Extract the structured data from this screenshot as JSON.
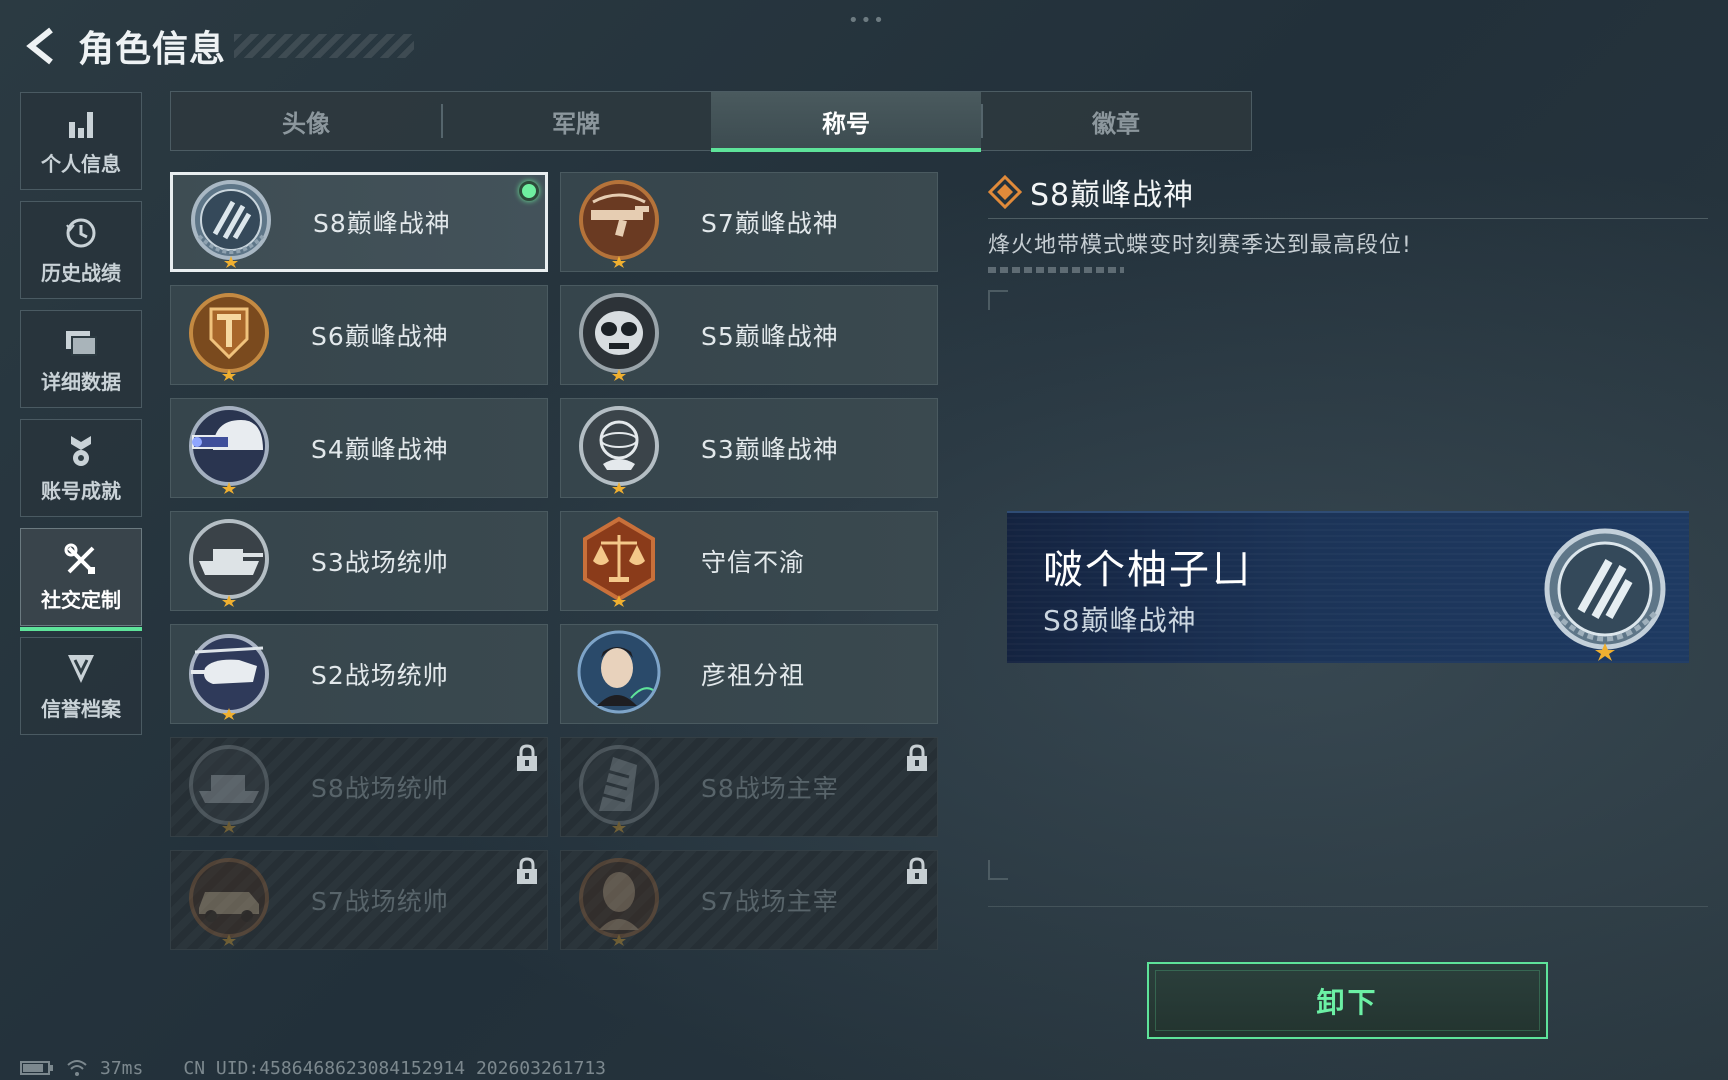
{
  "header": {
    "title": "角色信息",
    "top_dots": "•••"
  },
  "sidebar": {
    "items": [
      {
        "label": "个人信息",
        "icon": "bar-chart-icon"
      },
      {
        "label": "历史战绩",
        "icon": "history-clock-icon"
      },
      {
        "label": "详细数据",
        "icon": "folder-icon"
      },
      {
        "label": "账号成就",
        "icon": "medal-icon"
      },
      {
        "label": "社交定制",
        "icon": "tools-icon",
        "active": true
      },
      {
        "label": "信誉档案",
        "icon": "shield-badge-icon"
      }
    ]
  },
  "tabs": [
    {
      "label": "头像"
    },
    {
      "label": "军牌"
    },
    {
      "label": "称号",
      "active": true
    },
    {
      "label": "徽章"
    }
  ],
  "titles": [
    {
      "label": "S8巅峰战神",
      "badge": "s8-peak-emblem-icon",
      "state": "selected-equipped"
    },
    {
      "label": "S7巅峰战神",
      "badge": "s7-rifle-emblem-icon",
      "state": "owned"
    },
    {
      "label": "S6巅峰战神",
      "badge": "s6-t-shield-emblem-icon",
      "state": "owned"
    },
    {
      "label": "S5巅峰战神",
      "badge": "s5-skull-mask-emblem-icon",
      "state": "owned"
    },
    {
      "label": "S4巅峰战神",
      "badge": "s4-helmet-nvg-emblem-icon",
      "state": "owned"
    },
    {
      "label": "S3巅峰战神",
      "badge": "s3-armillary-emblem-icon",
      "state": "owned"
    },
    {
      "label": "S3战场统帅",
      "badge": "s3-tank-emblem-icon",
      "state": "owned"
    },
    {
      "label": "守信不渝",
      "badge": "scales-of-justice-emblem-icon",
      "state": "owned"
    },
    {
      "label": "S2战场统帅",
      "badge": "s2-helicopter-emblem-icon",
      "state": "owned"
    },
    {
      "label": "彦祖分祖",
      "badge": "portrait-emblem-icon",
      "state": "owned"
    },
    {
      "label": "S8战场统帅",
      "badge": "s8-tank-emblem-icon",
      "state": "locked"
    },
    {
      "label": "S8战场主宰",
      "badge": "s8-building-emblem-icon",
      "state": "locked"
    },
    {
      "label": "S7战场统帅",
      "badge": "s7-vehicle-emblem-icon",
      "state": "locked"
    },
    {
      "label": "S7战场主宰",
      "badge": "s7-warrior-emblem-icon",
      "state": "locked"
    }
  ],
  "detail": {
    "title": "S8巅峰战神",
    "description": "烽火地带模式蝶变时刻赛季达到最高段位!"
  },
  "preview": {
    "player_name": "啵个柚子ㄩ",
    "title": "S8巅峰战神"
  },
  "actions": {
    "unequip_label": "卸下"
  },
  "footer": {
    "ping": "37ms",
    "uid": "CN UID:4586468623084152914 202603261713"
  },
  "colors": {
    "accent_green": "#5ee39a",
    "bronze": "#b5733a",
    "preview_blue": "#1c3458"
  }
}
